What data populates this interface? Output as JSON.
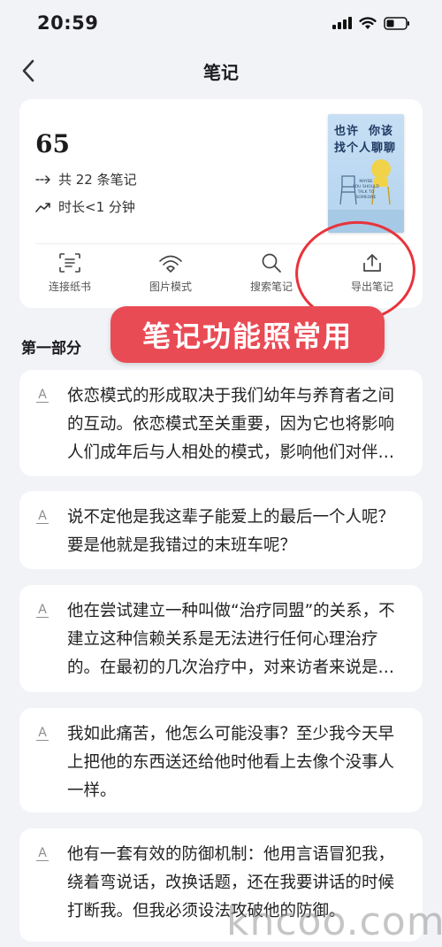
{
  "status_bar": {
    "time": "20:59",
    "icons": [
      "signal-icon",
      "wifi-icon",
      "battery-icon"
    ]
  },
  "nav": {
    "title": "笔记",
    "back_icon": "chevron-left-icon"
  },
  "summary": {
    "score": "65",
    "notes_count": "共 22 条笔记",
    "duration": "时长<1 分钟",
    "book_cover": {
      "title": "也许  你该\n找个人聊聊",
      "subtitle": "MAYBE\nYOU SHOULD\nTALK TO\nSOMEONE"
    }
  },
  "actions": [
    {
      "label": "连接纸书",
      "icon": "scan-text-icon"
    },
    {
      "label": "图片模式",
      "icon": "image-mode-icon"
    },
    {
      "label": "搜索笔记",
      "icon": "search-icon"
    },
    {
      "label": "导出笔记",
      "icon": "export-icon"
    }
  ],
  "annotation": {
    "banner": "笔记功能照常用"
  },
  "section": {
    "title": "第一部分"
  },
  "notes": [
    {
      "icon": "underline-icon",
      "text": "依恋模式的形成取决于我们幼年与养育者之间的互动。依恋模式至关重要，因为它也将影响人们成年后与人相处的模式，影响他们对伴侣的选择以及关系的发展。"
    },
    {
      "icon": "underline-icon",
      "text": "说不定他是我这辈子能爱上的最后一个人呢？要是他就是我错过的末班车呢？"
    },
    {
      "icon": "underline-icon",
      "text": "他在尝试建立一种叫做“治疗同盟”的关系，不建立这种信赖关系是无法进行任何心理治疗的。在最初的几次治疗中，对来访者来说是一种考验。"
    },
    {
      "icon": "underline-icon",
      "text": "我如此痛苦，他怎么可能没事？至少我今天早上把他的东西送还给他时他看上去像个没事人一样。"
    },
    {
      "icon": "underline-icon",
      "text": "他有一套有效的防御机制：他用言语冒犯我，绕着弯说话，改换话题，还在我要讲话的时候打断我。但我必须设法攻破他的防御。"
    }
  ],
  "watermark": "khcoo.com"
}
